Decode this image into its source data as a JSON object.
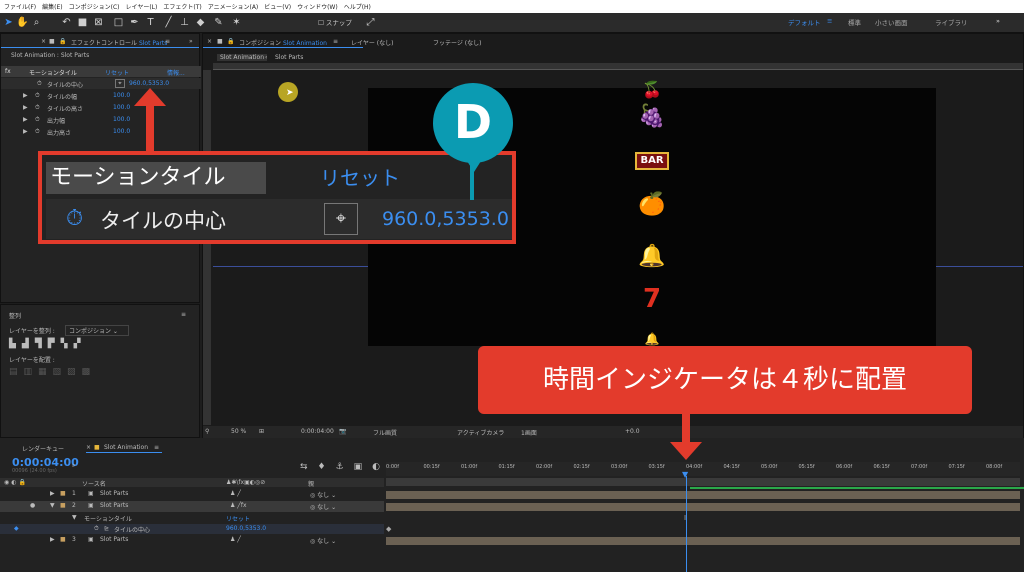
{
  "menu": [
    "ファイル(F)",
    "編集(E)",
    "コンポジション(C)",
    "レイヤー(L)",
    "エフェクト(T)",
    "アニメーション(A)",
    "ビュー(V)",
    "ウィンドウ(W)",
    "ヘルプ(H)"
  ],
  "toolbar": {
    "snap": "スナップ",
    "workspaces": [
      "デフォルト",
      "標準",
      "小さい画面",
      "ライブラリ"
    ],
    "more": "»"
  },
  "effect_panel": {
    "tab": "エフェクトコントロール",
    "layer": "Slot Parts",
    "subtitle": "Slot Animation : Slot Parts",
    "rows": [
      {
        "name": "モーションタイル",
        "value": "リセット",
        "extra": "情報..."
      },
      {
        "name": "タイルの中心",
        "value": "960.0,5353.0"
      },
      {
        "name": "タイルの幅",
        "value": "100.0"
      },
      {
        "name": "タイルの高さ",
        "value": "100.0"
      },
      {
        "name": "出力幅",
        "value": "100.0"
      },
      {
        "name": "出力高さ",
        "value": "100.0"
      }
    ]
  },
  "align_panel": {
    "title": "整列",
    "align_to_label": "レイヤーを整列 :",
    "align_to_value": "コンポジション",
    "distribute_label": "レイヤーを配置 :"
  },
  "comp_panel": {
    "tab": "コンポジション",
    "comp": "Slot Animation",
    "layer_tab": "レイヤー (なし)",
    "footage_tab": "フッテージ (なし)",
    "breadcrumb": [
      "Slot Animation",
      "Slot Parts"
    ],
    "footer": {
      "zoom": "50 %",
      "time": "0:00:04:00",
      "quality": "フル画質",
      "camera": "アクティブカメラ",
      "view": "1画面",
      "exposure": "+0.0"
    },
    "symbols": [
      "🍒",
      "🍇",
      "BAR",
      "🍊",
      "🔔",
      "7",
      "🔔"
    ]
  },
  "callout": {
    "header": "モーションタイル",
    "reset": "リセット",
    "param": "タイルの中心",
    "value": "960.0,5353.0",
    "badge": "D"
  },
  "note": "時間インジケータは４秒に配置",
  "timeline": {
    "render_queue": "レンダーキュー",
    "tab": "Slot Animation",
    "timecode": "0:00:04:00",
    "fps": "00096 (24.00 fps)",
    "col_source": "ソース名",
    "col_parent": "親",
    "ruler": [
      "0:00f",
      "00:15f",
      "01:00f",
      "01:15f",
      "02:00f",
      "02:15f",
      "03:00f",
      "03:15f",
      "04:00f",
      "04:15f",
      "05:00f",
      "05:15f",
      "06:00f",
      "06:15f",
      "07:00f",
      "07:15f",
      "08:00f"
    ],
    "layers": [
      {
        "num": "1",
        "name": "Slot Parts",
        "parent": "なし"
      },
      {
        "num": "2",
        "name": "Slot Parts",
        "parent": "なし"
      },
      {
        "num": "",
        "name": "モーションタイル",
        "parent": "リセット"
      },
      {
        "num": "",
        "name": "タイルの中心",
        "parent": "960.0,5353.0"
      },
      {
        "num": "3",
        "name": "Slot Parts",
        "parent": "なし"
      }
    ]
  }
}
